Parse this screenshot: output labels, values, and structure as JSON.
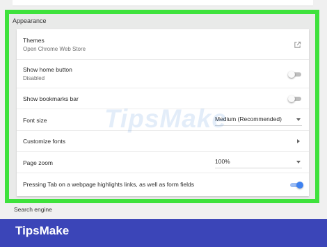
{
  "section": {
    "title": "Appearance"
  },
  "themes": {
    "title": "Themes",
    "subtitle": "Open Chrome Web Store",
    "icon": "external-link-icon"
  },
  "home_button": {
    "title": "Show home button",
    "subtitle": "Disabled",
    "enabled": false
  },
  "bookmarks_bar": {
    "title": "Show bookmarks bar",
    "enabled": false
  },
  "font_size": {
    "title": "Font size",
    "value": "Medium (Recommended)"
  },
  "customize_fonts": {
    "title": "Customize fonts"
  },
  "page_zoom": {
    "title": "Page zoom",
    "value": "100%"
  },
  "tab_highlight": {
    "title": "Pressing Tab on a webpage highlights links, as well as form fields",
    "enabled": true
  },
  "next_section": {
    "title": "Search engine"
  },
  "watermark": {
    "text": "TipsMake"
  },
  "brand": {
    "text": "TipsMake"
  },
  "colors": {
    "highlight": "#3ee23c",
    "banner": "#3b45b8",
    "toggle_on": "#3f82f0"
  }
}
